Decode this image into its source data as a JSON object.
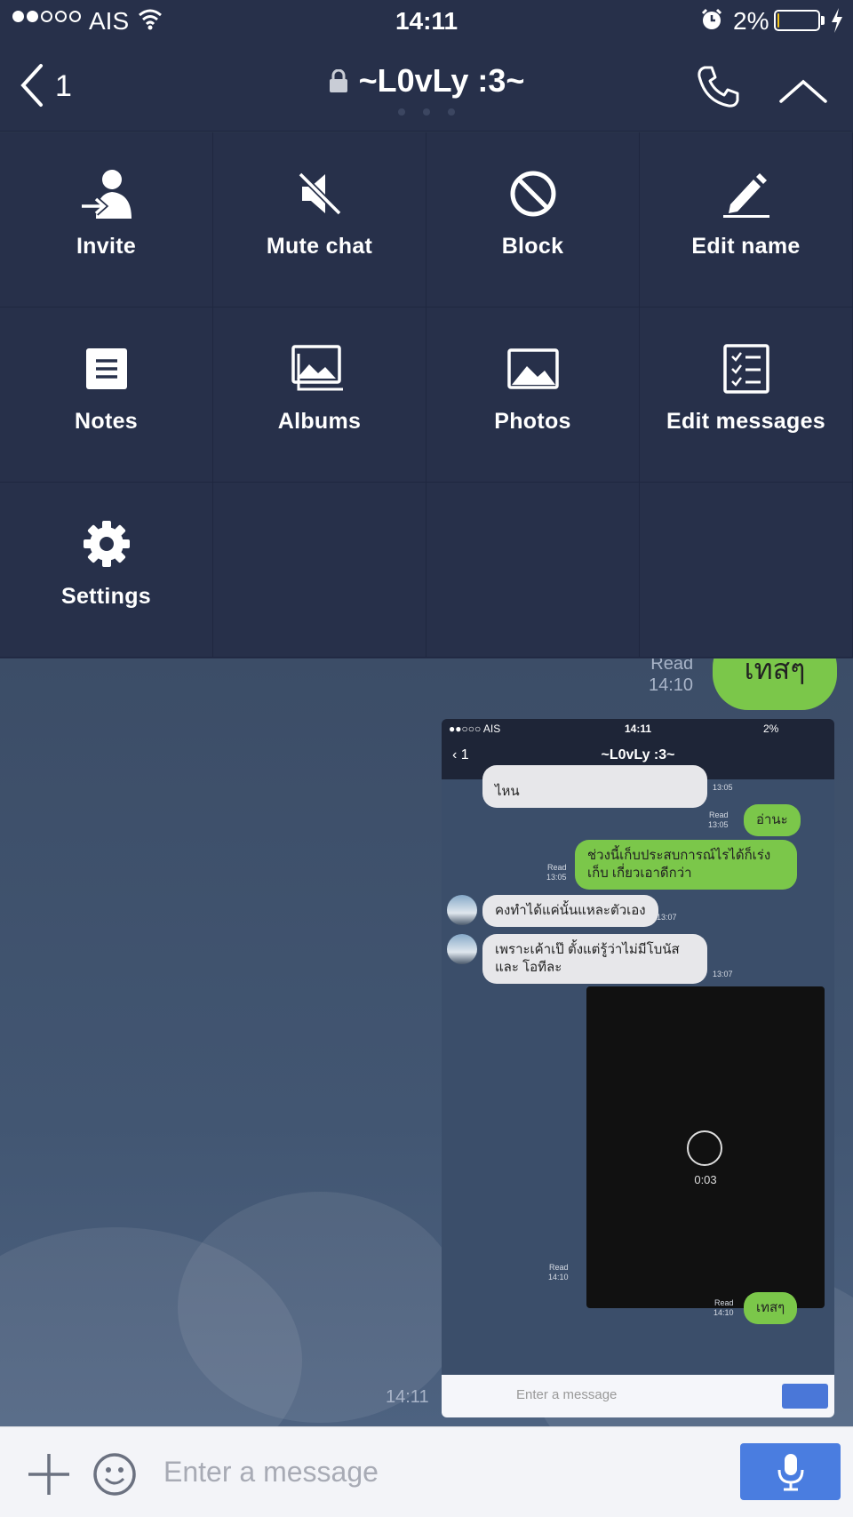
{
  "status_bar": {
    "carrier": "AIS",
    "time": "14:11",
    "battery": "2%",
    "battery_level": 0.02
  },
  "header": {
    "back_count": "1",
    "title": "~L0vLy :3~"
  },
  "menu": {
    "items": [
      {
        "label": "Invite",
        "icon": "invite-icon"
      },
      {
        "label": "Mute chat",
        "icon": "mute-icon"
      },
      {
        "label": "Block",
        "icon": "block-icon"
      },
      {
        "label": "Edit name",
        "icon": "pencil-icon"
      },
      {
        "label": "Notes",
        "icon": "notes-icon"
      },
      {
        "label": "Albums",
        "icon": "albums-icon"
      },
      {
        "label": "Photos",
        "icon": "photo-icon"
      },
      {
        "label": "Edit messages",
        "icon": "checklist-icon"
      },
      {
        "label": "Settings",
        "icon": "gear-icon"
      }
    ]
  },
  "chat": {
    "last_message": {
      "read": "Read",
      "time": "14:10",
      "text": "เทสๆ"
    },
    "footer_time": "14:11",
    "screenshot": {
      "carrier": "AIS",
      "time": "14:11",
      "battery": "2%",
      "back_count": "1",
      "title": "~L0vLy :3~",
      "messages": [
        {
          "dir": "in",
          "text": "ไหน",
          "time": "13:05"
        },
        {
          "dir": "out",
          "text": "อ่านะ",
          "read": "Read",
          "time": "13:05"
        },
        {
          "dir": "out",
          "text": "ช่วงนี้เก็บประสบการณ์ไรได้ก็เร่งเก็บ เกี่ยวเอาดีกว่า",
          "read": "Read",
          "time": "13:05"
        },
        {
          "dir": "in",
          "text": "คงทำได้แค่นั้นแหละตัวเอง",
          "time": "13:07"
        },
        {
          "dir": "in",
          "text": "เพราะเค้าเป๊ ตั้งแต่รู้ว่าไม่มีโบนัสและ โอทีละ",
          "time": "13:07"
        },
        {
          "dir": "out",
          "text": "เทสๆ",
          "read": "Read",
          "time": "14:10"
        }
      ],
      "video": {
        "duration": "0:03",
        "read": "Read",
        "time": "14:10"
      },
      "input_placeholder": "Enter a message"
    }
  },
  "input": {
    "placeholder": "Enter a message"
  },
  "colors": {
    "menu_bg": "#27304a",
    "accent_blue": "#4a7de0",
    "bubble_green": "#7bc74a"
  }
}
